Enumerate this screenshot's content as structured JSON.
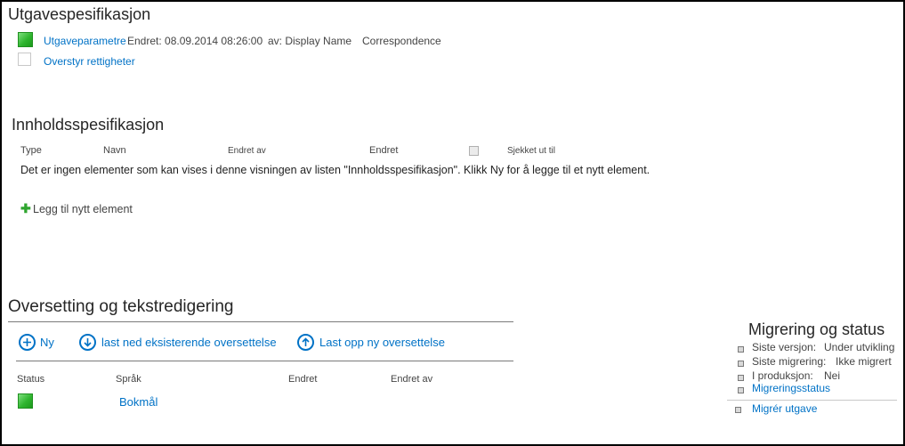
{
  "utgave": {
    "title": "Utgavespesifikasjon",
    "param_link": "Utgaveparametre",
    "changed": "Endret: 08.09.2014 08:26:00",
    "by": "av: Display Name",
    "type": "Correspondence",
    "override_link": "Overstyr rettigheter"
  },
  "innhold": {
    "title": "Innholdsspesifikasjon",
    "columns": {
      "type": "Type",
      "name": "Navn",
      "changed_by": "Endret av",
      "changed": "Endret",
      "checked_out": "Sjekket ut til"
    },
    "empty_message": "Det er ingen elementer som kan vises i denne visningen av listen \"Innholdsspesifikasjon\". Klikk Ny for å legge til et nytt element.",
    "add_link": "Legg til nytt element"
  },
  "oversetting": {
    "title": "Oversetting og tekstredigering",
    "actions": {
      "new": "Ny",
      "download": "last ned eksisterende oversettelse",
      "upload": "Last opp ny oversettelse"
    },
    "columns": {
      "status": "Status",
      "language": "Språk",
      "changed": "Endret",
      "changed_by": "Endret av"
    },
    "rows": [
      {
        "language": "Bokmål"
      }
    ]
  },
  "migrering": {
    "title": "Migrering og status",
    "items": [
      {
        "label": "Siste versjon:",
        "value": "Under utvikling"
      },
      {
        "label": "Siste migrering:",
        "value": "Ikke migrert"
      },
      {
        "label": "I produksjon:",
        "value": "Nei"
      }
    ],
    "status_link": "Migreringsstatus",
    "migrate_link": "Migrér utgave"
  },
  "colors": {
    "link": "#0072c6",
    "status_ok": "#2fb52f"
  }
}
